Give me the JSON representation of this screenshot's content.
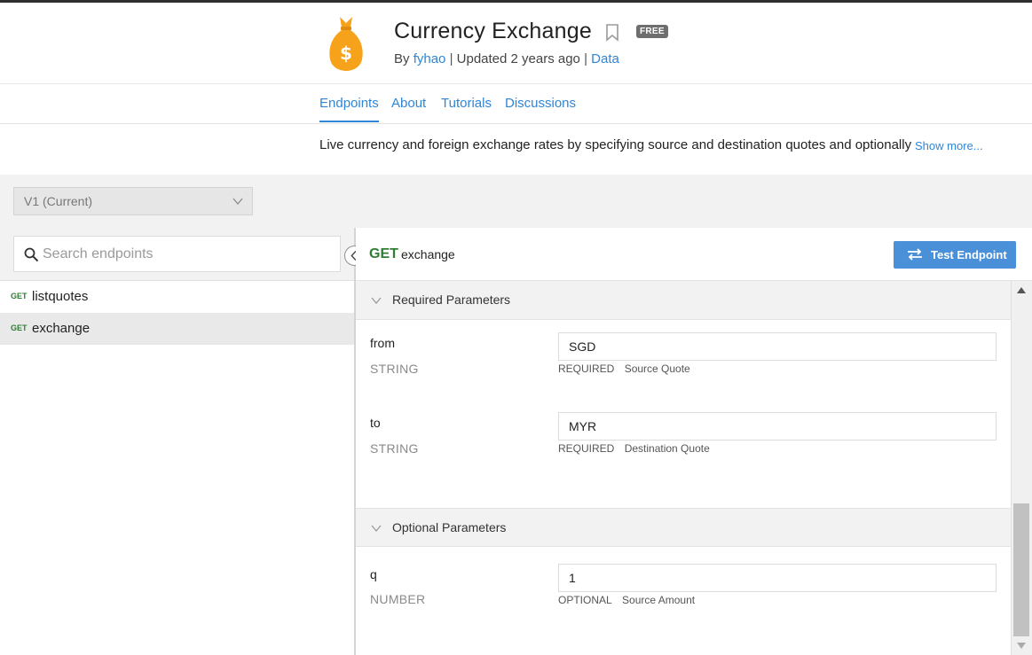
{
  "header": {
    "title": "Currency Exchange",
    "badge": "FREE",
    "by_label": "By",
    "author": "fyhao",
    "separator": "|",
    "updated": "Updated 2 years ago",
    "category": "Data",
    "icons": {
      "logo": "money-bag-icon",
      "bookmark": "bookmark-icon"
    },
    "colors": {
      "accent": "#2f86d6",
      "logo": "#f7a21b"
    }
  },
  "tabs": [
    {
      "label": "Endpoints",
      "active": true
    },
    {
      "label": "About",
      "active": false
    },
    {
      "label": "Tutorials",
      "active": false
    },
    {
      "label": "Discussions",
      "active": false
    }
  ],
  "description": {
    "text": "Live currency and foreign exchange rates by specifying source and destination quotes and optionally",
    "show_more": "Show more..."
  },
  "version_select": {
    "value": "V1 (Current)"
  },
  "sidebar": {
    "search": {
      "placeholder": "Search endpoints",
      "value": ""
    },
    "endpoints": [
      {
        "method": "GET",
        "name": "listquotes",
        "selected": false
      },
      {
        "method": "GET",
        "name": "exchange",
        "selected": true
      }
    ]
  },
  "endpoint": {
    "method": "GET",
    "name": "exchange",
    "test_button": "Test Endpoint",
    "method_color": "#2e7d32",
    "button_color": "#4a90d9"
  },
  "required_section": {
    "title": "Required Parameters",
    "params": [
      {
        "name": "from",
        "type": "STRING",
        "value": "SGD",
        "flag": "REQUIRED",
        "note": "Source Quote"
      },
      {
        "name": "to",
        "type": "STRING",
        "value": "MYR",
        "flag": "REQUIRED",
        "note": "Destination Quote"
      }
    ]
  },
  "optional_section": {
    "title": "Optional Parameters",
    "params": [
      {
        "name": "q",
        "type": "NUMBER",
        "value": "1",
        "flag": "OPTIONAL",
        "note": "Source Amount"
      }
    ]
  }
}
